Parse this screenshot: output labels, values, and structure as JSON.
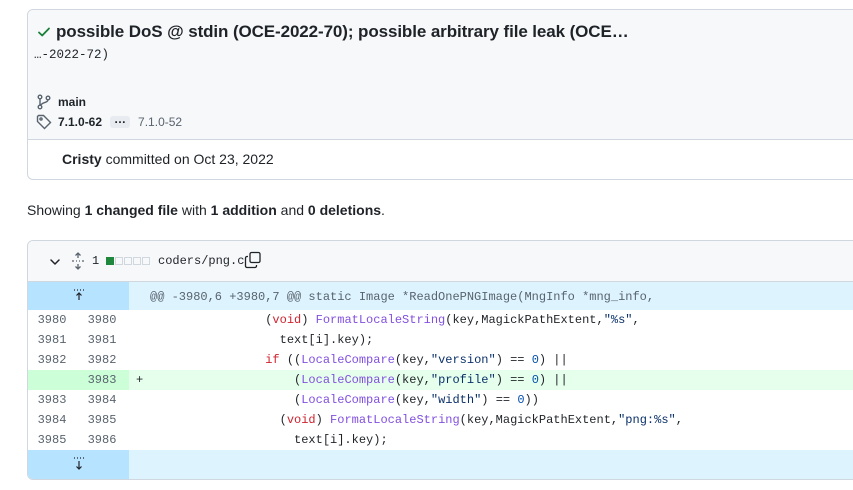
{
  "commit": {
    "title": "possible DoS @ stdin (OCE-2022-70); possible arbitrary file leak (OCE…",
    "title_cont": "…-2022-72)",
    "branch": "main",
    "tag_primary": "7.1.0-62",
    "tag_ellipsis": "…",
    "tag_secondary": "7.1.0-52",
    "author": "Cristy",
    "committed_text": " committed on Oct 23, 2022"
  },
  "summary": {
    "prefix": "Showing ",
    "changed": "1 changed file",
    "with": " with ",
    "additions": "1 addition",
    "and": " and ",
    "deletions": "0 deletions",
    "suffix": "."
  },
  "file": {
    "change_count": "1",
    "name": "coders/png.c",
    "hunk_header": "@@ -3980,6 +3980,7 @@ static Image *ReadOnePNGImage(MngInfo *mng_info,",
    "lines": [
      {
        "old": "3980",
        "new": "3980",
        "sign": "",
        "added": false
      },
      {
        "old": "3981",
        "new": "3981",
        "sign": "",
        "added": false
      },
      {
        "old": "3982",
        "new": "3982",
        "sign": "",
        "added": false
      },
      {
        "old": "",
        "new": "3983",
        "sign": "+",
        "added": true
      },
      {
        "old": "3983",
        "new": "3984",
        "sign": "",
        "added": false
      },
      {
        "old": "3984",
        "new": "3985",
        "sign": "",
        "added": false
      },
      {
        "old": "3985",
        "new": "3986",
        "sign": "",
        "added": false
      }
    ],
    "code": [
      [
        "                (",
        "void",
        ") ",
        "FormatLocaleString",
        "(key,MagickPathExtent,",
        "\"%s\"",
        ","
      ],
      [
        "                  text[i].key);"
      ],
      [
        "                ",
        "if",
        " ((",
        "LocaleCompare",
        "(key,",
        "\"version\"",
        ") == ",
        "0",
        ") ||"
      ],
      [
        "                    (",
        "LocaleCompare",
        "(key,",
        "\"profile\"",
        ") == ",
        "0",
        ") ||"
      ],
      [
        "                    (",
        "LocaleCompare",
        "(key,",
        "\"width\"",
        ") == ",
        "0",
        "))"
      ],
      [
        "                  (",
        "void",
        ") ",
        "FormatLocaleString",
        "(key,MagickPathExtent,",
        "\"png:%s\"",
        ","
      ],
      [
        "                    text[i].key);"
      ]
    ]
  },
  "colors": {
    "added_bg": "#e6ffec",
    "added_gutter": "#ccffd8",
    "hunk_bg": "#ddf4ff",
    "hunk_gutter": "#b6e3ff",
    "check": "#1a7f37"
  }
}
